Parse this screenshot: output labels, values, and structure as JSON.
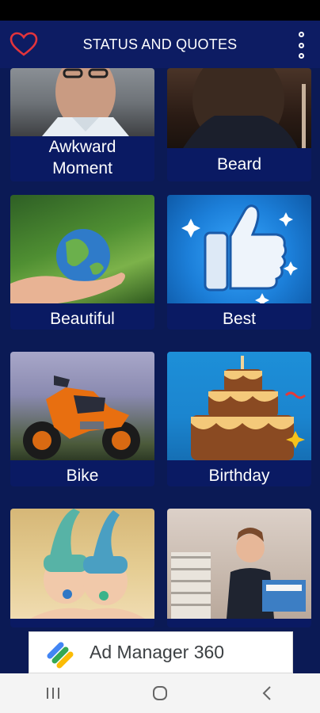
{
  "header": {
    "title": "STATUS AND QUOTES",
    "favorite_icon": "heart-outline-icon",
    "menu_icon": "more-vertical-icon"
  },
  "categories": [
    {
      "label": "Awkward\nMoment",
      "image": "man-with-glasses"
    },
    {
      "label": "Beard",
      "image": "bearded-man"
    },
    {
      "label": "Beautiful",
      "image": "hand-holding-globe"
    },
    {
      "label": "Best",
      "image": "thumbs-up"
    },
    {
      "label": "Bike",
      "image": "orange-motorbike"
    },
    {
      "label": "Birthday",
      "image": "birthday-cake"
    },
    {
      "label": "",
      "image": "babies-in-knit-hats"
    },
    {
      "label": "",
      "image": "woman-at-office-desk"
    }
  ],
  "ad": {
    "text": "Ad Manager 360"
  },
  "navigation": {
    "recent_icon": "recent-apps-icon",
    "home_icon": "home-icon",
    "back_icon": "back-icon"
  },
  "colors": {
    "background": "#0b1a55",
    "appbar": "#0d1c63",
    "heart": "#e2343c"
  }
}
